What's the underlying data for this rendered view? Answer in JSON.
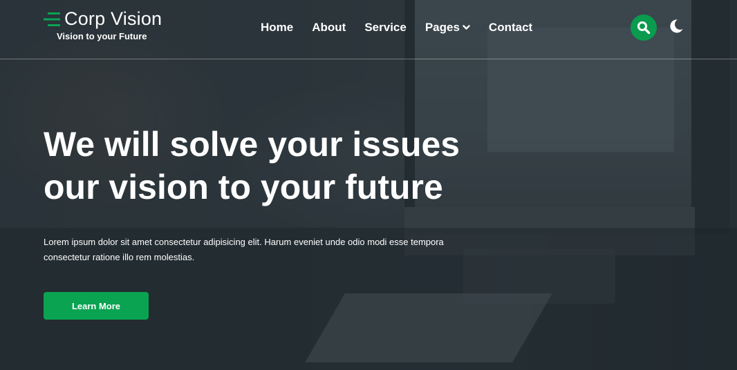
{
  "brand": {
    "name": "Corp Vision",
    "tagline": "Vision to your Future",
    "accent_color": "#0aa352"
  },
  "nav": {
    "items": [
      {
        "label": "Home"
      },
      {
        "label": "About"
      },
      {
        "label": "Service"
      },
      {
        "label": "Pages",
        "has_dropdown": true
      },
      {
        "label": "Contact"
      }
    ]
  },
  "header_actions": {
    "search_icon": "search-icon",
    "theme_icon": "moon-icon"
  },
  "hero": {
    "title_line1": "We will solve your issues",
    "title_line2": "our vision to your future",
    "description": "Lorem ipsum dolor sit amet consectetur adipisicing elit. Harum eveniet unde odio modi esse tempora consectetur ratione illo rem molestias.",
    "cta_label": "Learn More"
  }
}
